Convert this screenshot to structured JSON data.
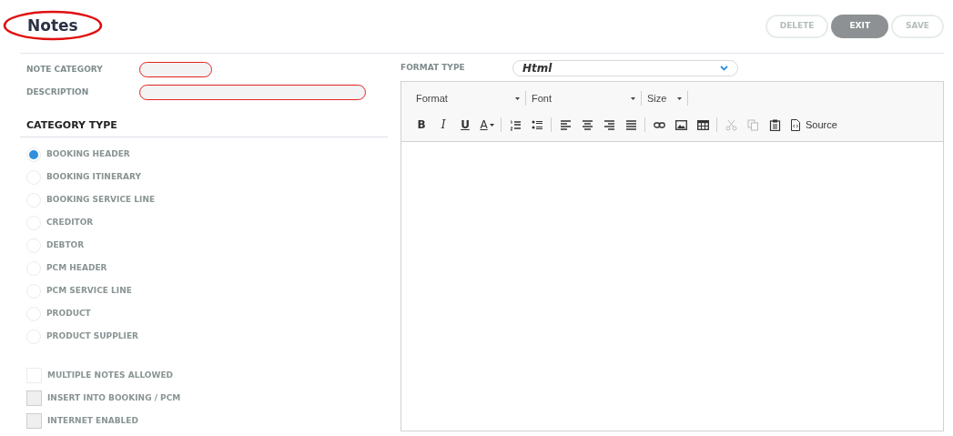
{
  "title": "Notes",
  "buttons": [
    {
      "label": "DELETE",
      "disabled": true
    },
    {
      "label": "EXIT",
      "disabled": false
    },
    {
      "label": "SAVE",
      "disabled": true
    }
  ],
  "fields": [
    {
      "label": "NOTE CATEGORY",
      "invalid": true
    },
    {
      "label": "DESCRIPTION",
      "invalid": true
    }
  ],
  "category_type": {
    "heading": "CATEGORY TYPE",
    "options": [
      {
        "label": "BOOKING HEADER",
        "selected": true
      },
      {
        "label": "BOOKING ITINERARY",
        "selected": false
      },
      {
        "label": "BOOKING SERVICE LINE",
        "selected": false
      },
      {
        "label": "CREDITOR",
        "selected": false
      },
      {
        "label": "DEBTOR",
        "selected": false
      },
      {
        "label": "PCM HEADER",
        "selected": false
      },
      {
        "label": "PCM SERVICE LINE",
        "selected": false
      },
      {
        "label": "PRODUCT",
        "selected": false
      },
      {
        "label": "PRODUCT SUPPLIER",
        "selected": false
      }
    ]
  },
  "checkboxes": [
    {
      "label": "MULTIPLE NOTES ALLOWED",
      "checked": false,
      "disabled": false
    },
    {
      "label": "INSERT INTO BOOKING / PCM",
      "checked": false,
      "disabled": true
    },
    {
      "label": "INTERNET ENABLED",
      "checked": false,
      "disabled": true
    }
  ],
  "format_type": {
    "label": "FORMAT TYPE",
    "value": "Html"
  },
  "toolbar": {
    "combos": [
      {
        "label": "Format"
      },
      {
        "label": "Font"
      },
      {
        "label": "Size"
      }
    ],
    "groups": [
      [
        {
          "kind": "bold",
          "label": "B",
          "disabled": false
        },
        {
          "kind": "italic",
          "label": "I",
          "disabled": false
        },
        {
          "kind": "underline",
          "label": "U",
          "disabled": false
        },
        {
          "kind": "text-color",
          "label": "A",
          "disabled": false
        }
      ],
      [
        {
          "kind": "numbered-list",
          "disabled": false
        },
        {
          "kind": "bullet-list",
          "disabled": false
        }
      ],
      [
        {
          "kind": "align-left",
          "disabled": false
        },
        {
          "kind": "align-center",
          "disabled": false
        },
        {
          "kind": "align-right",
          "disabled": false
        },
        {
          "kind": "justify",
          "disabled": false
        }
      ],
      [
        {
          "kind": "link",
          "disabled": false
        },
        {
          "kind": "image",
          "disabled": false
        },
        {
          "kind": "table",
          "disabled": false
        }
      ],
      [
        {
          "kind": "cut",
          "disabled": true
        },
        {
          "kind": "copy",
          "disabled": true
        },
        {
          "kind": "paste",
          "disabled": false
        },
        {
          "kind": "source",
          "label": "Source",
          "disabled": false
        }
      ]
    ]
  }
}
